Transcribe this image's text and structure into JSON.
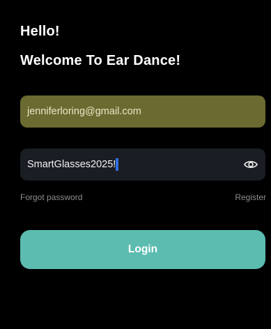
{
  "header": {
    "greeting": "Hello!",
    "welcome": "Welcome To Ear Dance!"
  },
  "form": {
    "email_value": "jenniferloring@gmail.com",
    "password_value": "SmartGlasses2025!",
    "show_password_icon": "eye-icon",
    "forgot_password_label": "Forgot password",
    "register_label": "Register",
    "login_label": "Login"
  },
  "colors": {
    "background": "#000000",
    "email_field_highlight": "#6b6a30",
    "password_field": "#1b1d24",
    "accent": "#5cbcb0",
    "muted_link": "#8e8e8e",
    "caret": "#2f6fe0"
  }
}
